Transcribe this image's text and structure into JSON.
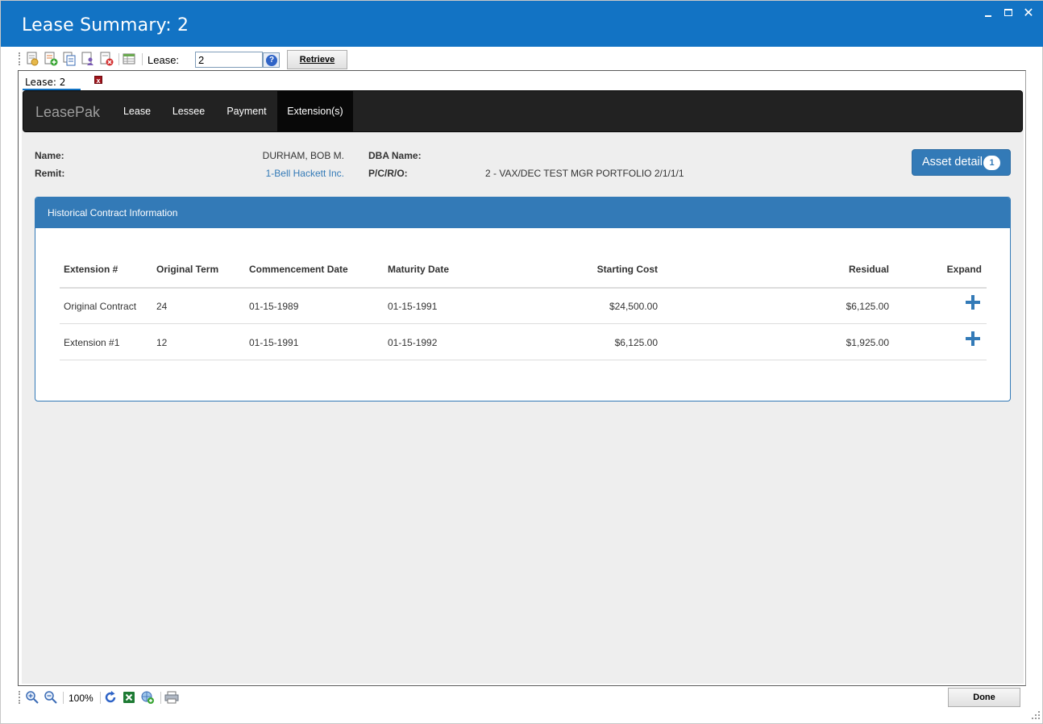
{
  "window": {
    "title": "Lease Summary: 2",
    "controls": [
      "minimize-icon",
      "maximize-icon",
      "close-icon"
    ],
    "title_bar_color": "#1273c4"
  },
  "toolbar": {
    "icons": [
      "new-document-icon",
      "add-document-icon",
      "copy-document-icon",
      "user-document-icon",
      "delete-document-icon",
      "grid-report-icon"
    ],
    "lease_label": "Lease:",
    "lease_value": "2",
    "help_label": "?",
    "retrieve_label": "Retrieve"
  },
  "doc_tab": {
    "label": "Lease: 2",
    "close_label": "x"
  },
  "navbar": {
    "brand": "LeasePak",
    "items": [
      {
        "label": "Lease",
        "active": false
      },
      {
        "label": "Lessee",
        "active": false
      },
      {
        "label": "Payment",
        "active": false
      },
      {
        "label": "Extension(s)",
        "active": true
      }
    ],
    "background": "#222222",
    "active_background": "#080808"
  },
  "info": {
    "name_label": "Name:",
    "name_value": "DURHAM, BOB M.",
    "dba_label": "DBA Name:",
    "dba_value": "",
    "remit_label": "Remit:",
    "remit_value": "1-Bell Hackett Inc.",
    "pcro_label": "P/C/R/O:",
    "pcro_value": "2 - VAX/DEC TEST MGR PORTFOLIO 2/1/1/1"
  },
  "asset_button": {
    "label": "Asset detail",
    "badge": "1",
    "color": "#337ab7"
  },
  "panel": {
    "title": "Historical Contract Information",
    "columns": [
      "Extension #",
      "Original Term",
      "Commencement Date",
      "Maturity Date",
      "Starting Cost",
      "Residual",
      "Expand"
    ],
    "rows": [
      {
        "extension": "Original Contract",
        "term": "24",
        "commencement": "01-15-1989",
        "maturity": "01-15-1991",
        "starting_cost": "$24,500.00",
        "residual": "$6,125.00",
        "expand_icon": "plus-icon"
      },
      {
        "extension": "Extension #1",
        "term": "12",
        "commencement": "01-15-1991",
        "maturity": "01-15-1992",
        "starting_cost": "$6,125.00",
        "residual": "$1,925.00",
        "expand_icon": "plus-icon"
      }
    ]
  },
  "statusbar": {
    "icons": [
      "zoom-in-icon",
      "zoom-out-icon",
      "refresh-icon",
      "excel-export-icon",
      "web-export-icon",
      "print-icon"
    ],
    "zoom": "100%",
    "done_label": "Done"
  }
}
